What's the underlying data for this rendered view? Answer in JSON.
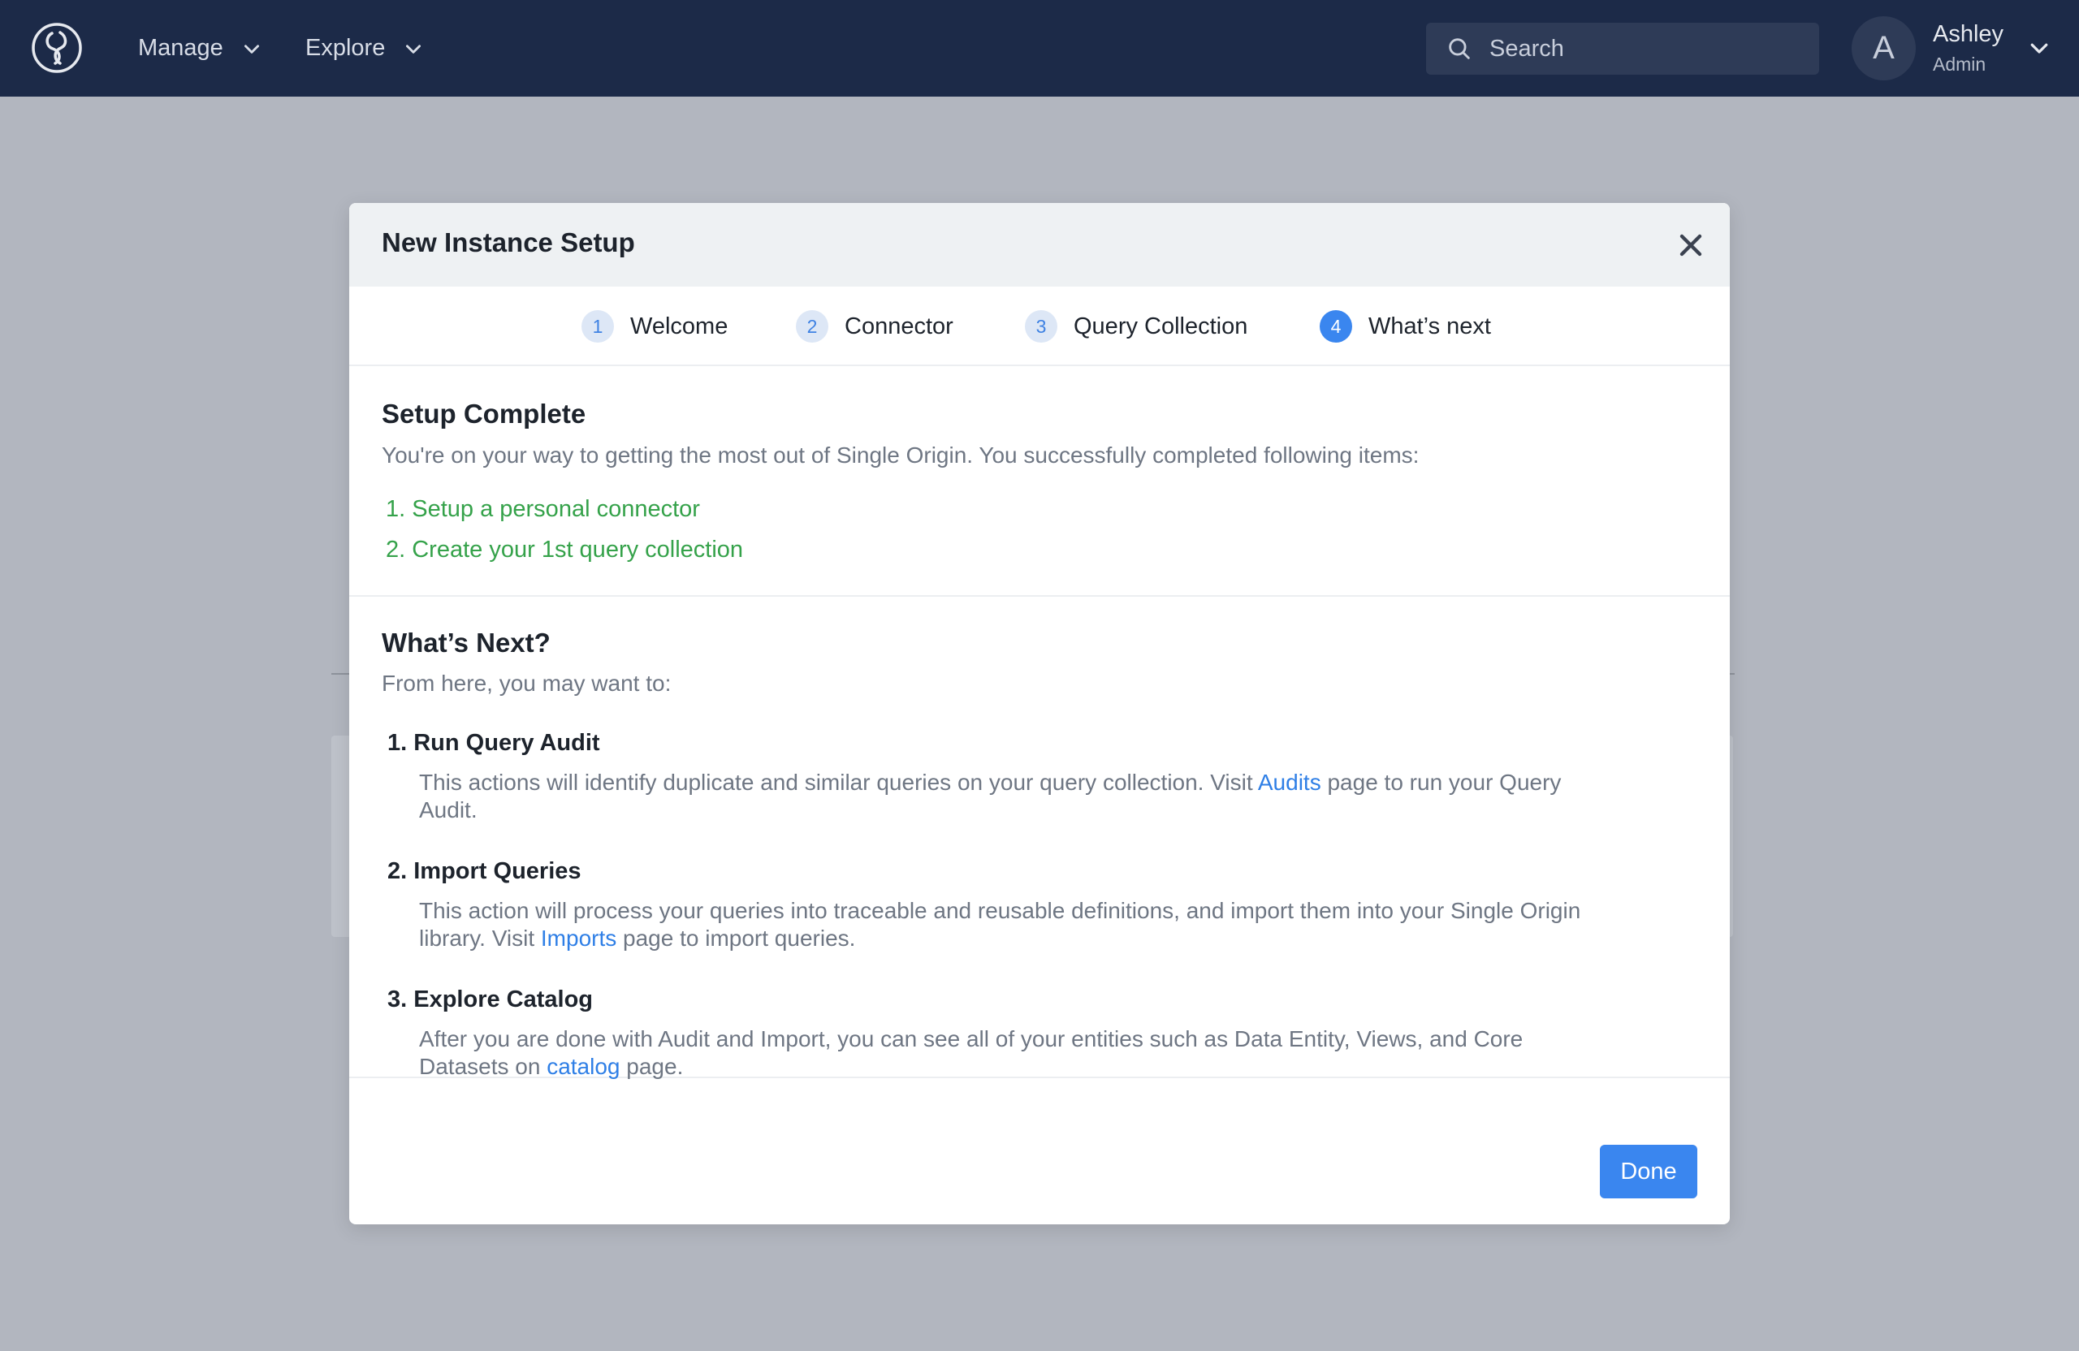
{
  "nav": {
    "logo_icon": "single-origin-logo-icon",
    "menus": [
      {
        "label": "Manage",
        "icon": "chevron-down-icon"
      },
      {
        "label": "Explore",
        "icon": "chevron-down-icon"
      }
    ],
    "search": {
      "placeholder": "Search",
      "icon": "search-icon"
    },
    "user": {
      "initial": "A",
      "name": "Ashley",
      "role": "Admin",
      "icon": "chevron-down-icon"
    }
  },
  "modal": {
    "title": "New Instance Setup",
    "close_icon": "close-icon",
    "steps": [
      {
        "number": "1",
        "label": "Welcome",
        "active": false
      },
      {
        "number": "2",
        "label": "Connector",
        "active": false
      },
      {
        "number": "3",
        "label": "Query Collection",
        "active": false
      },
      {
        "number": "4",
        "label": "What’s next",
        "active": true
      }
    ],
    "complete": {
      "heading": "Setup Complete",
      "subtitle": "You're on your way to getting the most out of Single Origin. You successfully completed following items:",
      "items": [
        "1. Setup a personal connector",
        "2. Create your 1st query collection"
      ]
    },
    "next": {
      "heading": "What’s Next?",
      "subtitle": "From here, you may want to:",
      "tasks": [
        {
          "title": "1. Run Query Audit",
          "before": "This actions will identify duplicate and similar queries on your query collection. Visit ",
          "link": "Audits",
          "after": " page to run your Query Audit."
        },
        {
          "title": "2. Import Queries",
          "before": "This action will process your queries into traceable and reusable definitions, and import them into your Single Origin library. Visit ",
          "link": "Imports",
          "after": " page to import queries."
        },
        {
          "title": "3. Explore Catalog",
          "before": "After you are done with Audit and Import, you can see all of your entities such as Data Entity, Views, and Core Datasets on ",
          "link": "catalog",
          "after": " page."
        }
      ]
    },
    "done_label": "Done"
  },
  "colors": {
    "nav_bg": "#1c2a48",
    "overlay_bg": "#b2b6bf",
    "accent": "#3a86ef",
    "success": "#35a24a",
    "link": "#2f7fe6"
  }
}
